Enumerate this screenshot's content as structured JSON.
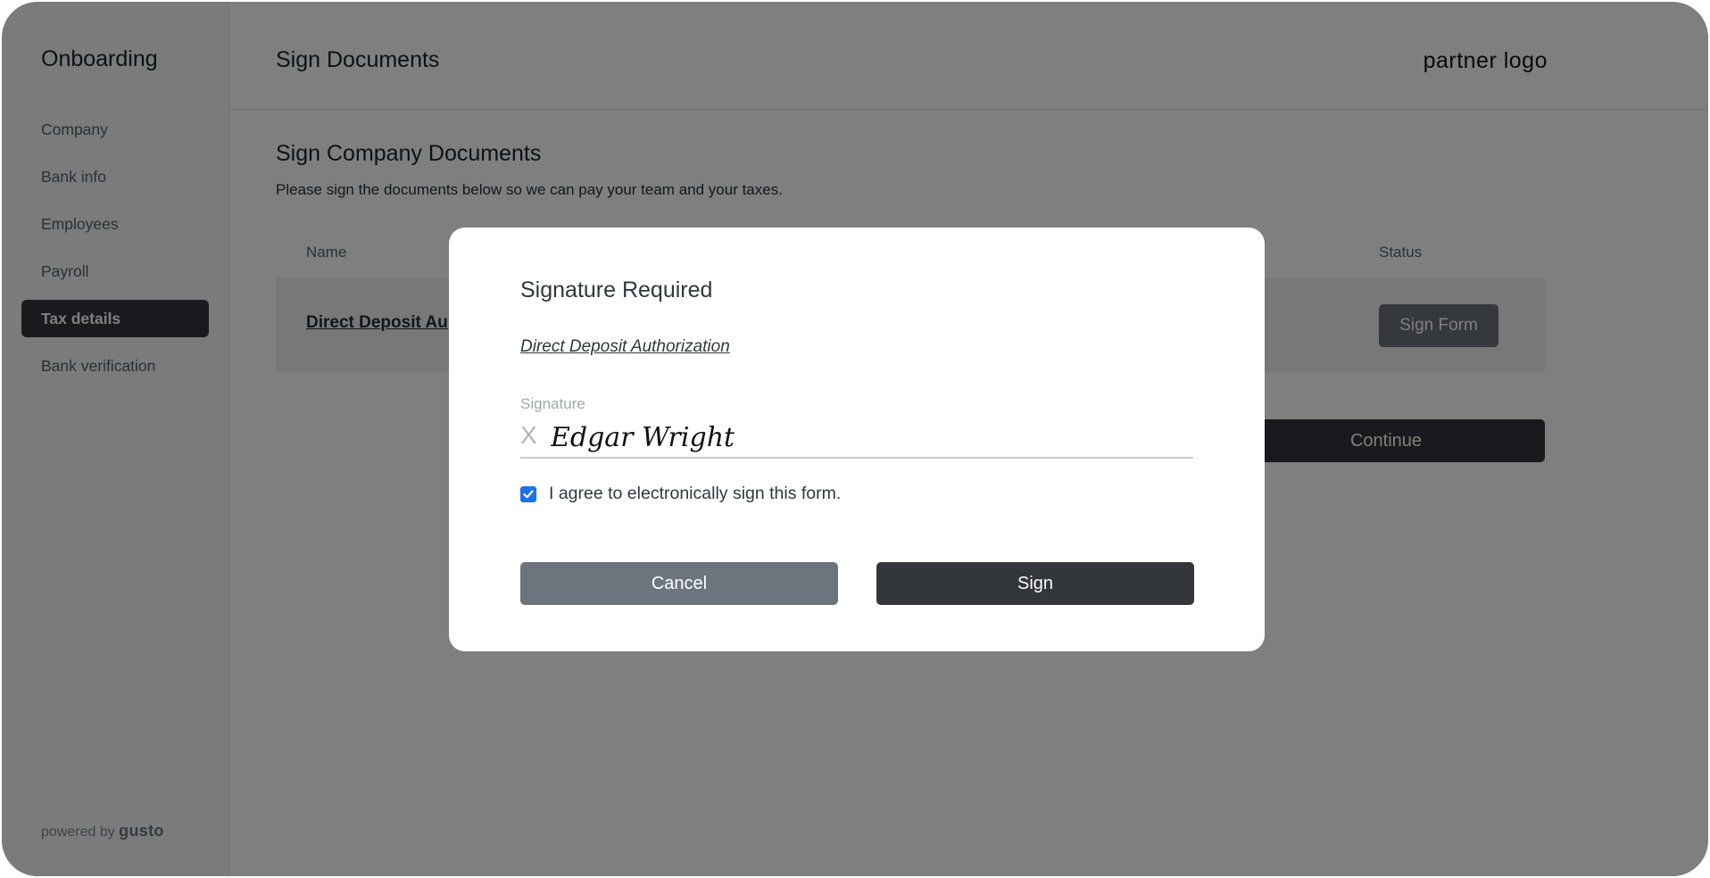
{
  "sidebar": {
    "title": "Onboarding",
    "items": [
      {
        "label": "Company",
        "active": false
      },
      {
        "label": "Bank info",
        "active": false
      },
      {
        "label": "Employees",
        "active": false
      },
      {
        "label": "Payroll",
        "active": false
      },
      {
        "label": "Tax details",
        "active": true
      },
      {
        "label": "Bank verification",
        "active": false
      }
    ],
    "powered_by": "powered by",
    "powered_brand": "gusto"
  },
  "header": {
    "title": "Sign Documents",
    "partner_logo": "partner logo"
  },
  "main": {
    "section_title": "Sign Company Documents",
    "description": "Please sign the documents below so we can pay your team and your taxes.",
    "table": {
      "columns": [
        "Name",
        "Status"
      ],
      "rows": [
        {
          "name": "Direct Deposit Au",
          "action": "Sign Form"
        }
      ]
    },
    "continue_label": "Continue"
  },
  "modal": {
    "title": "Signature Required",
    "document_link": "Direct Deposit Authorization",
    "signature_label": "Signature",
    "signature_prefix": "X",
    "signature_value": "Edgar Wright",
    "agree_checked": true,
    "agree_label": "I agree to electronically sign this form.",
    "cancel_label": "Cancel",
    "sign_label": "Sign"
  },
  "colors": {
    "overlay": "#000000",
    "checkbox": "#1a73e8",
    "primary_button": "#33363b",
    "secondary_button": "#6c757d"
  }
}
